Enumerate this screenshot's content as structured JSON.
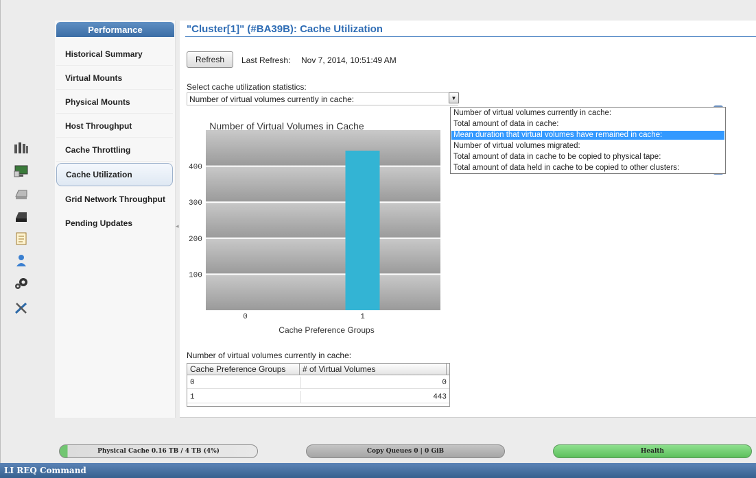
{
  "nav": {
    "header": "Performance",
    "items": [
      {
        "label": "Historical Summary"
      },
      {
        "label": "Virtual Mounts"
      },
      {
        "label": "Physical Mounts"
      },
      {
        "label": "Host Throughput"
      },
      {
        "label": "Cache Throttling"
      },
      {
        "label": "Cache Utilization"
      },
      {
        "label": "Grid Network Throughput"
      },
      {
        "label": "Pending Updates"
      }
    ],
    "active": "Cache Utilization"
  },
  "rail_icons": [
    "cluster-icon",
    "monitor-icon",
    "disk-icon",
    "tape-drive-icon",
    "clipboard-icon",
    "user-icon",
    "gears-icon",
    "tools-icon"
  ],
  "main": {
    "title": "\"Cluster[1]\" (#BA39B): Cache Utilization",
    "refresh_label": "Refresh",
    "last_refresh_label": "Last Refresh:",
    "last_refresh_value": "Nov 7, 2014, 10:51:49 AM",
    "select_label": "Select cache utilization statistics:",
    "select_value": "Number of virtual volumes currently in cache:",
    "dropdown_options": [
      "Number of virtual volumes currently in cache:",
      "Total amount of data in cache:",
      "Mean duration that virtual volumes have remained in cache:",
      "Number of virtual volumes migrated:",
      "Total amount of data in cache to be copied to physical tape:",
      "Total amount of data held in cache to be copied to other clusters:"
    ],
    "dropdown_highlighted_index": 2,
    "table_label": "Number of virtual volumes currently in cache:",
    "table": {
      "headers": [
        "Cache Preference Groups",
        "# of Virtual Volumes"
      ],
      "rows": [
        [
          "0",
          "0"
        ],
        [
          "1",
          "443"
        ]
      ]
    }
  },
  "chart_data": {
    "type": "bar",
    "title": "Number of Virtual Volumes in Cache",
    "xlabel": "Cache Preference Groups",
    "ylabel": "",
    "categories": [
      "0",
      "1"
    ],
    "values": [
      0,
      443
    ],
    "yticks": [
      100,
      200,
      300,
      400
    ],
    "ylim": [
      0,
      500
    ],
    "bar_color": "#33b4d4",
    "grid": true,
    "legend": "none"
  },
  "status_bar": {
    "physical_cache": "Physical Cache 0.16 TB / 4 TB (4%)",
    "physical_cache_fraction": 0.04,
    "copy_queues": "Copy Queues 0 | 0 GiB",
    "health": "Health"
  },
  "footer": {
    "label": "LI REQ Command"
  },
  "colors": {
    "accent": "#2f6db5",
    "health": "#6fcf6f",
    "bar": "#33b4d4"
  }
}
